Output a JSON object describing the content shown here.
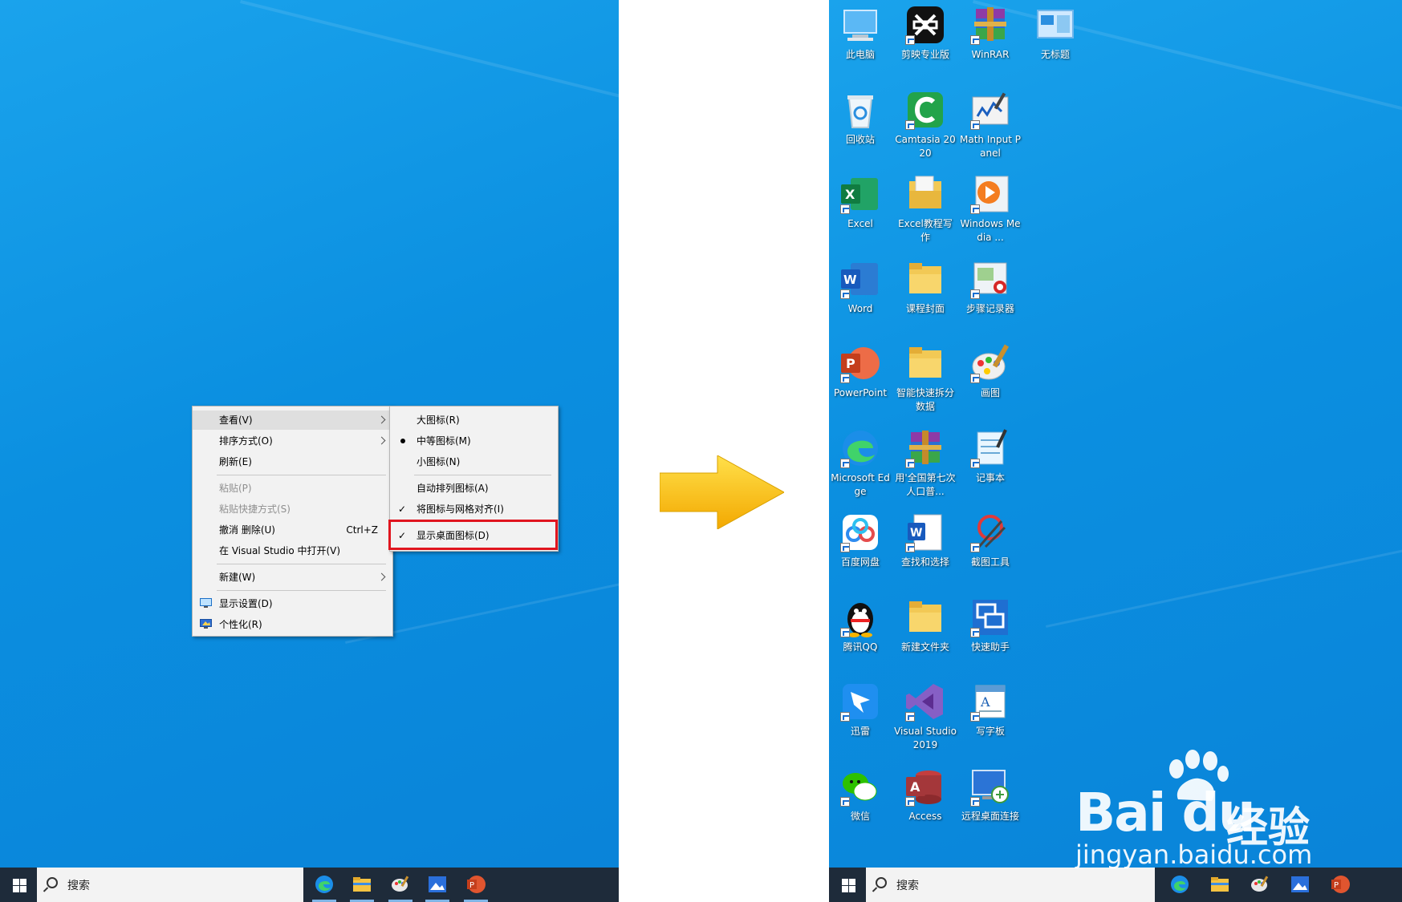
{
  "colors": {
    "desktop_blue": "#0b8fe0",
    "highlight_red": "#e0151f",
    "arrow_yellow": "#f7c200",
    "taskbar": "#1e2b3a"
  },
  "context_menu": {
    "items": [
      {
        "label": "查看(V)",
        "submenu": true
      },
      {
        "label": "排序方式(O)",
        "submenu": true
      },
      {
        "label": "刷新(E)"
      },
      {
        "label": "粘贴(P)",
        "disabled": true
      },
      {
        "label": "粘贴快捷方式(S)",
        "disabled": true
      },
      {
        "label": "撤消 删除(U)",
        "shortcut": "Ctrl+Z"
      },
      {
        "label": "在 Visual Studio 中打开(V)"
      },
      {
        "label": "新建(W)",
        "submenu": true
      },
      {
        "label": "显示设置(D)",
        "icon": "display-settings-icon"
      },
      {
        "label": "个性化(R)",
        "icon": "personalize-icon"
      }
    ]
  },
  "view_submenu": {
    "items": [
      {
        "label": "大图标(R)"
      },
      {
        "label": "中等图标(M)",
        "bullet": true
      },
      {
        "label": "小图标(N)"
      },
      {
        "label": "自动排列图标(A)"
      },
      {
        "label": "将图标与网格对齐(I)",
        "checked": true
      },
      {
        "label": "显示桌面图标(D)",
        "checked": true,
        "highlighted": true
      }
    ],
    "check_glyph": "✓"
  },
  "taskbar": {
    "search_placeholder": "搜索"
  },
  "desktop_icons": [
    {
      "label": "此电脑",
      "icon": "this-pc-icon"
    },
    {
      "label": "剪映专业版",
      "icon": "capcut-icon"
    },
    {
      "label": "WinRAR",
      "icon": "winrar-icon"
    },
    {
      "label": "无标题",
      "icon": "untitled-icon"
    },
    {
      "label": "回收站",
      "icon": "recycle-bin-icon"
    },
    {
      "label": "Camtasia 2020",
      "icon": "camtasia-icon"
    },
    {
      "label": "Math Input Panel",
      "icon": "math-input-icon"
    },
    {
      "label": "Excel",
      "icon": "excel-icon"
    },
    {
      "label": "Excel教程写作",
      "icon": "folder-doc-icon"
    },
    {
      "label": "Windows Media ...",
      "icon": "media-player-icon"
    },
    {
      "label": "Word",
      "icon": "word-icon"
    },
    {
      "label": "课程封面",
      "icon": "folder-icon"
    },
    {
      "label": "步骤记录器",
      "icon": "steps-recorder-icon"
    },
    {
      "label": "PowerPoint",
      "icon": "powerpoint-icon"
    },
    {
      "label": "智能快速拆分数据",
      "icon": "folder-icon"
    },
    {
      "label": "画图",
      "icon": "paint-icon"
    },
    {
      "label": "Microsoft Edge",
      "icon": "edge-icon"
    },
    {
      "label": "用'全国第七次人口普...",
      "icon": "winrar-icon"
    },
    {
      "label": "记事本",
      "icon": "notepad-icon"
    },
    {
      "label": "百度网盘",
      "icon": "baidu-netdisk-icon"
    },
    {
      "label": "查找和选择",
      "icon": "word-doc-icon"
    },
    {
      "label": "截图工具",
      "icon": "snipping-tool-icon"
    },
    {
      "label": "腾讯QQ",
      "icon": "qq-icon"
    },
    {
      "label": "新建文件夹",
      "icon": "folder-icon"
    },
    {
      "label": "快速助手",
      "icon": "quick-assist-icon"
    },
    {
      "label": "迅雷",
      "icon": "thunder-icon"
    },
    {
      "label": "Visual Studio 2019",
      "icon": "visual-studio-icon"
    },
    {
      "label": "写字板",
      "icon": "wordpad-icon"
    },
    {
      "label": "微信",
      "icon": "wechat-icon"
    },
    {
      "label": "Access",
      "icon": "access-icon"
    },
    {
      "label": "远程桌面连接",
      "icon": "remote-desktop-icon"
    }
  ],
  "watermark": {
    "brand": "Bai du",
    "brand_cn": "经验",
    "url": "jingyan.baidu.com"
  }
}
